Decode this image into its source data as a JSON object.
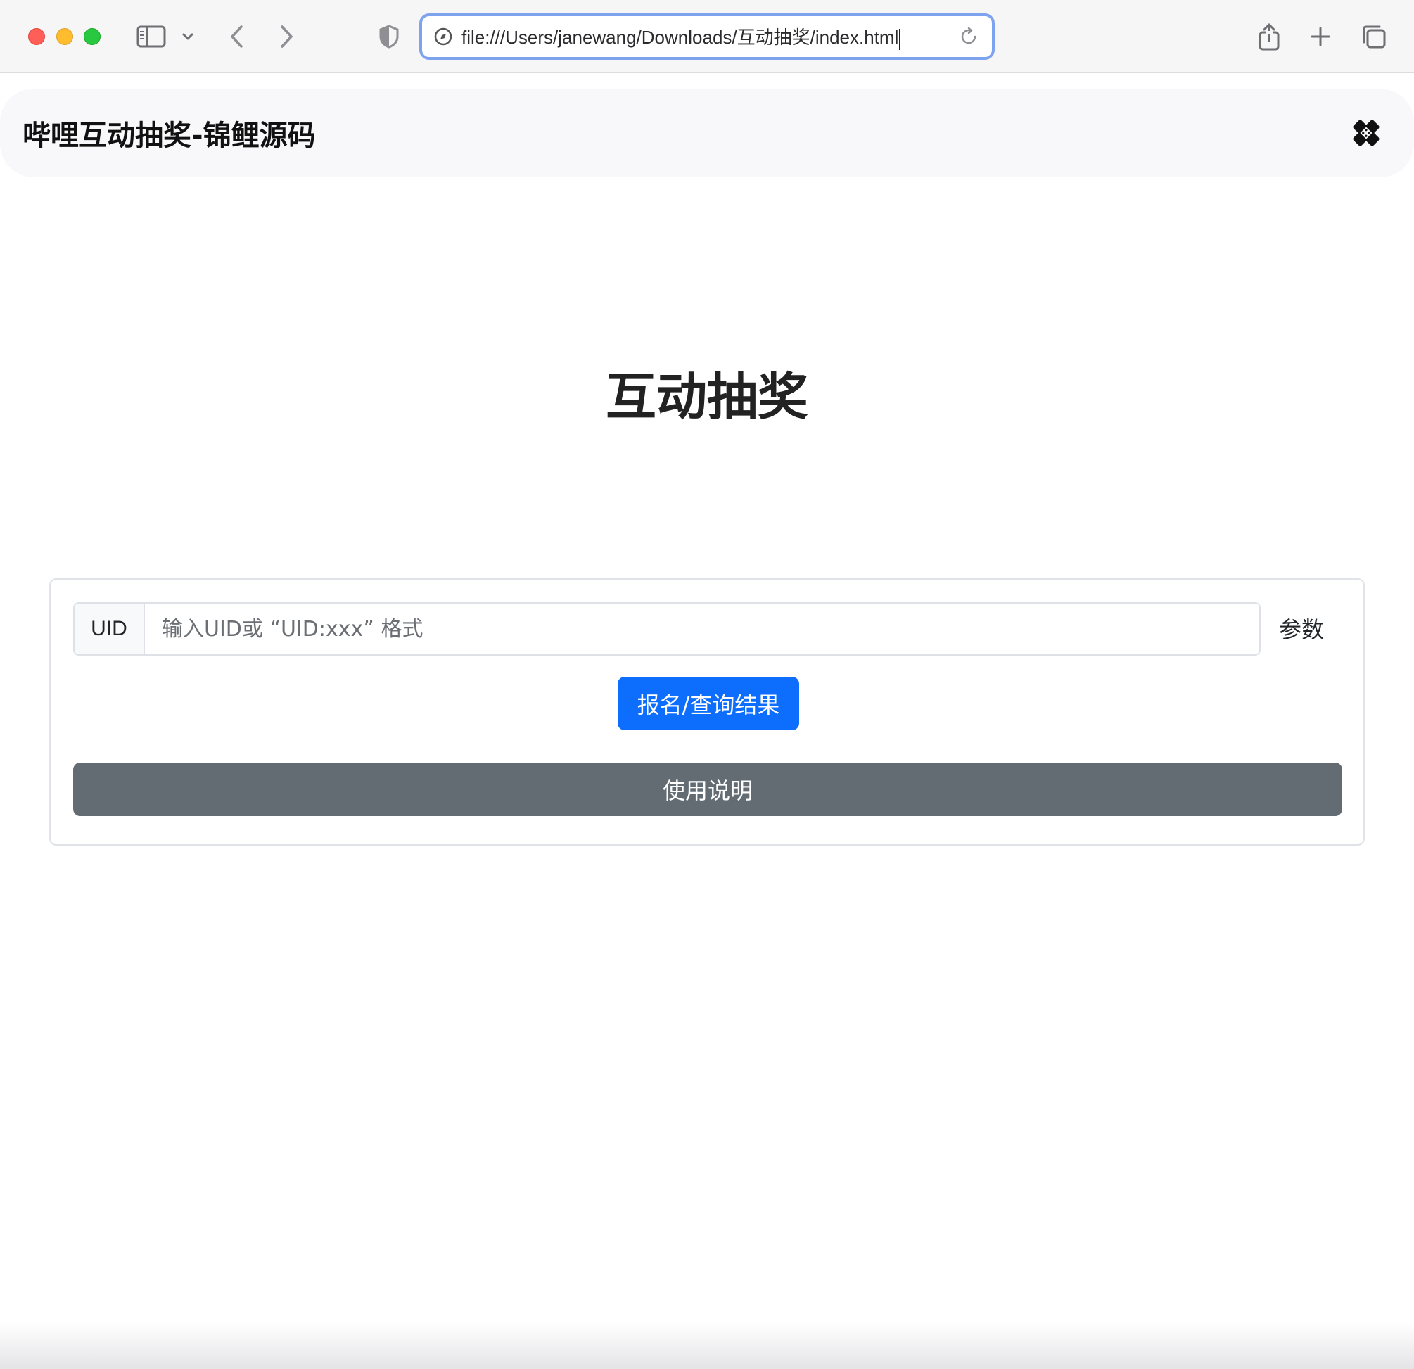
{
  "browser": {
    "url": "file:///Users/janewang/Downloads/互动抽奖/index.html",
    "icons": {
      "sidebar": "sidebar-icon",
      "chevron": "chevron-down-icon",
      "back": "back-arrow-icon",
      "forward": "forward-arrow-icon",
      "privacy": "shield-icon",
      "reload": "reload-icon",
      "share": "share-icon",
      "new_tab": "plus-icon",
      "tabs": "tab-overview-icon"
    }
  },
  "navbar": {
    "brand": "哔哩互动抽奖-锦鲤源码",
    "toggle_icon": "theme-toggle-icon"
  },
  "main": {
    "title": "互动抽奖"
  },
  "form": {
    "uid_label": "UID",
    "uid_placeholder": "输入UID或 “UID:xxx” 格式",
    "uid_value": "",
    "params_label": "参数",
    "submit_label": "报名/查询结果",
    "guide_label": "使用说明"
  },
  "colors": {
    "primary": "#0d6efd",
    "secondary": "#636c73",
    "address_focus": "#7ea3ee"
  }
}
